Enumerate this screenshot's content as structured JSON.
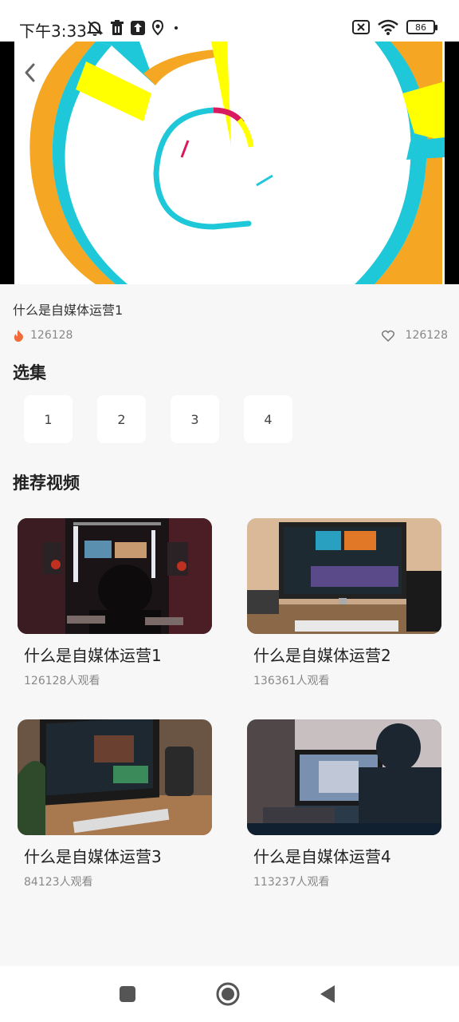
{
  "status": {
    "time": "下午3:33",
    "battery": "86"
  },
  "video": {
    "title": "什么是自媒体运营1",
    "play_count": "126128",
    "like_count": "126128"
  },
  "episodes": {
    "title": "选集",
    "items": [
      "1",
      "2",
      "3",
      "4"
    ]
  },
  "recommend": {
    "title": "推荐视频",
    "items": [
      {
        "title": "什么是自媒体运营1",
        "views": "126128人观看"
      },
      {
        "title": "什么是自媒体运营2",
        "views": "136361人观看"
      },
      {
        "title": "什么是自媒体运营3",
        "views": "84123人观看"
      },
      {
        "title": "什么是自媒体运营4",
        "views": "113237人观看"
      }
    ]
  },
  "colors": {
    "accent_orange": "#f5a623",
    "accent_cyan": "#1ec8d8",
    "accent_yellow": "#ffff00",
    "accent_pink": "#d81b60",
    "fire": "#f26b3a"
  }
}
